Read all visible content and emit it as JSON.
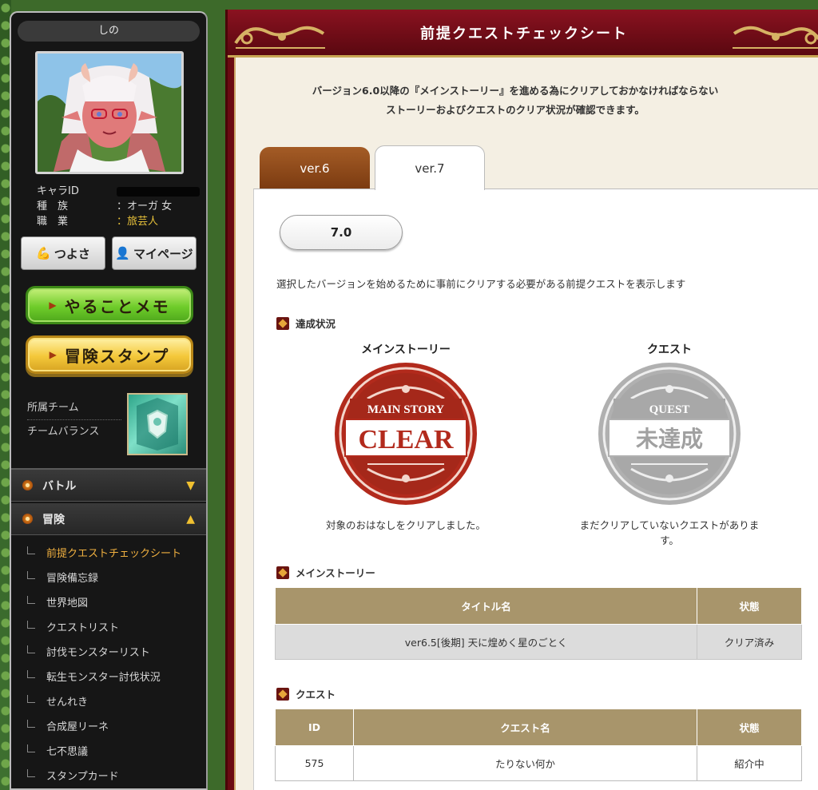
{
  "sidebar": {
    "character_name": "しの",
    "info": [
      {
        "label": "キャラID",
        "value": ""
      },
      {
        "label": "種　族",
        "value": "：オーガ 女"
      },
      {
        "label": "職　業",
        "value": "：旅芸人"
      }
    ],
    "buttons": {
      "strength": "つよさ",
      "mypage": "マイページ",
      "todo": "やることメモ",
      "stamp": "冒険スタンプ"
    },
    "team": {
      "affiliation": "所属チーム",
      "balance": "チームバランス"
    },
    "categories": [
      {
        "label": "バトル",
        "arrow": "▼"
      },
      {
        "label": "冒険",
        "arrow": "▲"
      }
    ],
    "sub_items": [
      "前提クエストチェックシート",
      "冒険備忘録",
      "世界地図",
      "クエストリスト",
      "討伐モンスターリスト",
      "転生モンスター討伐状況",
      "せんれき",
      "合成屋リーネ",
      "七不思議",
      "スタンプカード"
    ]
  },
  "main": {
    "title": "前提クエストチェックシート",
    "intro_line1": "バージョン6.0以降の『メインストーリー』を進める為にクリアしておかなければならない",
    "intro_line2": "ストーリーおよびクエストのクリア状況が確認できます。",
    "tabs": [
      "ver.6",
      "ver.7"
    ],
    "version_select": "7.0",
    "description": "選択したバージョンを始めるために事前にクリアする必要がある前提クエストを表示します",
    "status_heading": "達成状況",
    "main_story": {
      "heading": "メインストーリー",
      "stamp_top": "MAIN STORY",
      "stamp_main": "CLEAR",
      "note": "対象のおはなしをクリアしました。"
    },
    "quest": {
      "heading": "クエスト",
      "stamp_top": "QUEST",
      "stamp_main": "未達成",
      "note": "まだクリアしていないクエストがあります。"
    },
    "story_table": {
      "heading": "メインストーリー",
      "columns": [
        "タイトル名",
        "状態"
      ],
      "rows": [
        [
          "ver6.5[後期] 天に煌めく星のごとく",
          "クリア済み"
        ]
      ]
    },
    "quest_table": {
      "heading": "クエスト",
      "columns": [
        "ID",
        "クエスト名",
        "状態"
      ],
      "rows": [
        [
          "575",
          "たりない何か",
          "紹介中"
        ]
      ]
    }
  },
  "colors": {
    "header_red": "#6a0a12",
    "gold": "#c8a552",
    "clear_red": "#b22a1c",
    "table_header": "#a8956b",
    "active_menu": "#f0b040"
  }
}
